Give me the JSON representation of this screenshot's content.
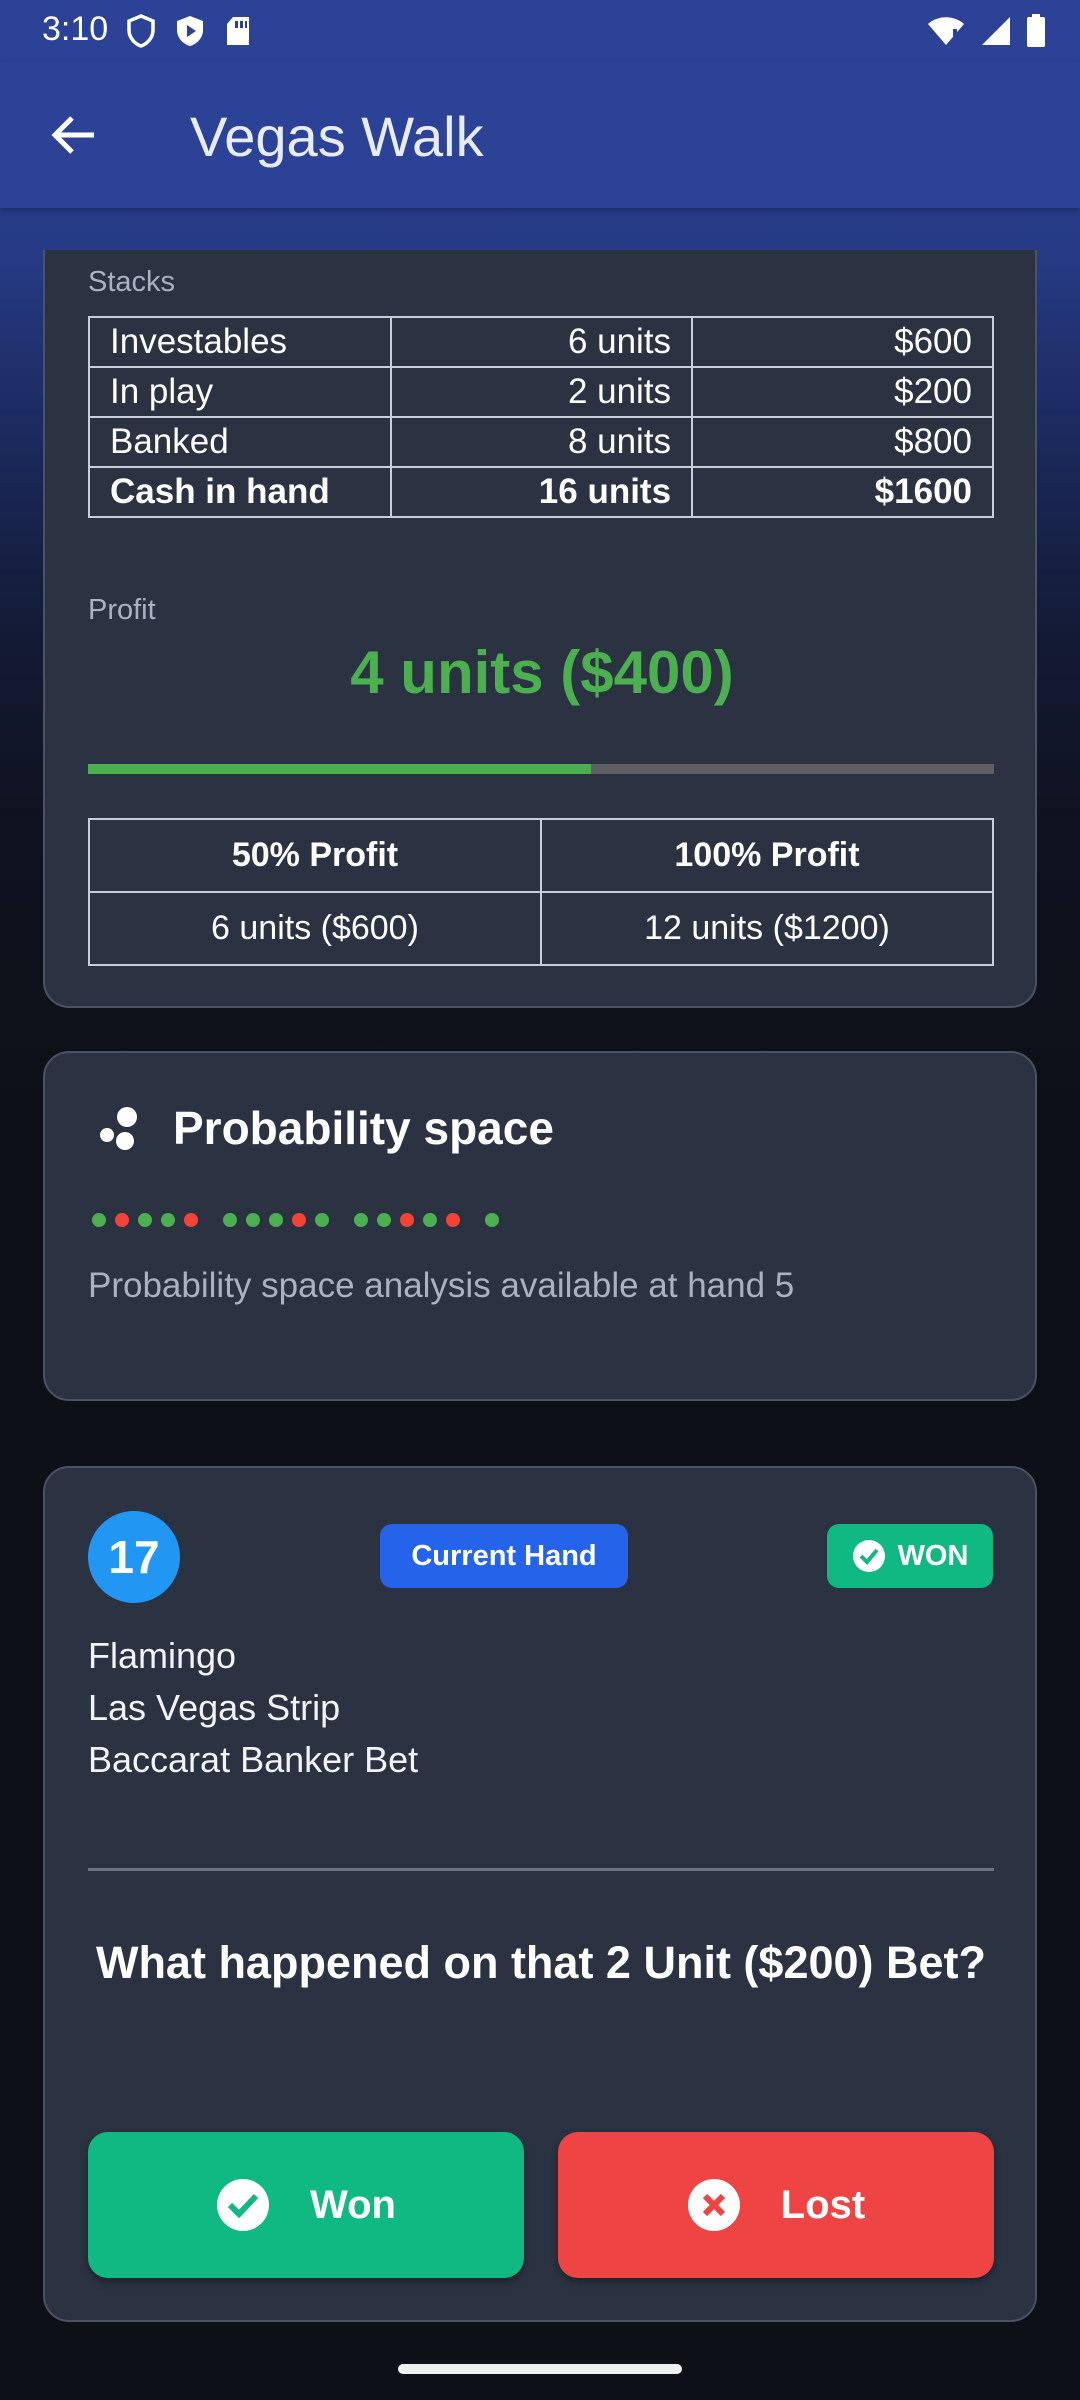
{
  "status_bar": {
    "time": "3:10"
  },
  "app_bar": {
    "title": "Vegas Walk"
  },
  "stacks": {
    "label": "Stacks",
    "rows": [
      {
        "name": "Investables",
        "units": "6 units",
        "amount": "$600"
      },
      {
        "name": "In play",
        "units": "2 units",
        "amount": "$200"
      },
      {
        "name": "Banked",
        "units": "8 units",
        "amount": "$800"
      },
      {
        "name": "Cash in hand",
        "units": "16 units",
        "amount": "$1600"
      }
    ]
  },
  "profit": {
    "label": "Profit",
    "value": "4 units ($400)",
    "progress_fraction": 0.555,
    "goals": {
      "headers": [
        "50% Profit",
        "100% Profit"
      ],
      "values": [
        "6 units ($600)",
        "12 units ($1200)"
      ]
    }
  },
  "probability": {
    "title": "Probability space",
    "dot_groups": [
      [
        "g",
        "r",
        "g",
        "g",
        "r"
      ],
      [
        "g",
        "g",
        "g",
        "r",
        "g"
      ],
      [
        "g",
        "g",
        "r",
        "g",
        "r"
      ],
      [
        "g"
      ]
    ],
    "text": "Probability space analysis available at hand 5"
  },
  "hand": {
    "number": "17",
    "current_badge": "Current Hand",
    "status_badge": "WON",
    "lines": [
      "Flamingo",
      "Las Vegas Strip",
      "Baccarat Banker Bet"
    ],
    "question": "What happened on that 2 Unit ($200) Bet?",
    "won_label": "Won",
    "lost_label": "Lost"
  },
  "colors": {
    "app_bar": "#2c4296",
    "card": "#2b3343",
    "profit_green": "#4caf50",
    "won_green": "#10b981",
    "lost_red": "#ef4444",
    "badge_blue": "#2563eb",
    "hand_circle": "#2196f3"
  }
}
